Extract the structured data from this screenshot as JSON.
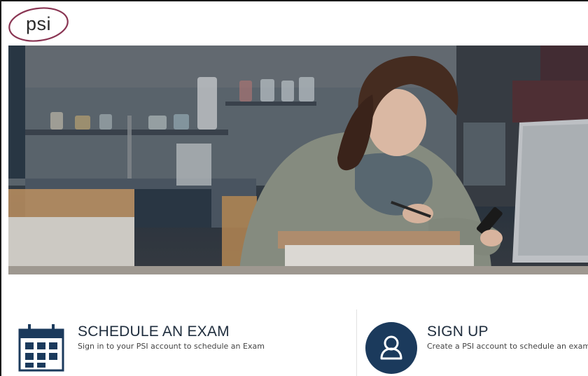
{
  "header": {
    "logo_text": "psi"
  },
  "hero": {
    "image": "woman-studying-with-laptop-and-phone-photo"
  },
  "actions": [
    {
      "title": "SCHEDULE AN EXAM",
      "subtitle": "Sign in to your PSI account to schedule an Exam",
      "icon": "calendar-icon"
    },
    {
      "title": "SIGN UP",
      "subtitle": "Create a PSI account to schedule an exam",
      "icon": "user-icon"
    }
  ],
  "colors": {
    "logo_ring": "#8a3553",
    "brand_navy": "#1b3a5c",
    "title_text": "#1f2d3d"
  }
}
